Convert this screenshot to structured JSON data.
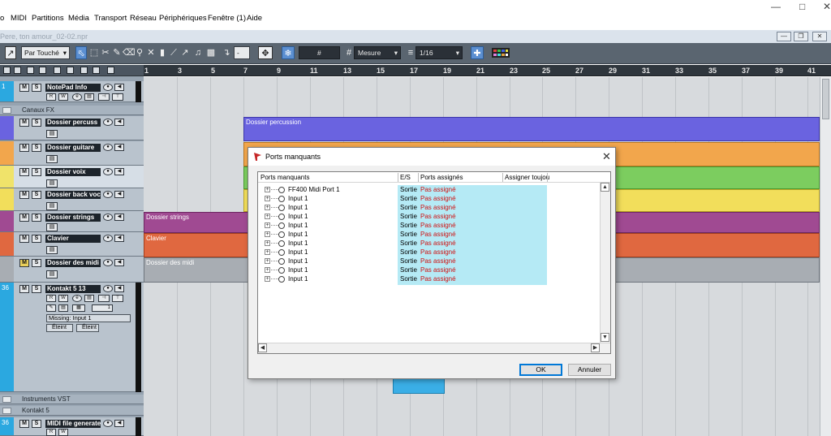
{
  "menubar": {
    "items": [
      "o",
      "MIDI",
      "Partitions",
      "Média",
      "Transport",
      "Réseau",
      "Périphériques",
      "Fenêtre (1)",
      "Aide"
    ]
  },
  "project": {
    "title": "Pere, ton amour_02-02.npr"
  },
  "toolbar": {
    "mode": "Par Touché",
    "grid_symbol": "#",
    "grid_type": "Mesure",
    "quantize": "1/16",
    "dash": "-"
  },
  "ruler": {
    "bars": [
      "1",
      "3",
      "5",
      "7",
      "9",
      "11",
      "13",
      "15",
      "17",
      "19",
      "21",
      "23",
      "25",
      "27",
      "29",
      "31",
      "33",
      "35",
      "37",
      "39",
      "41"
    ]
  },
  "tracks": {
    "notepad": {
      "num": "1",
      "name": "NotePad Info"
    },
    "fx_folder": "Canaux FX",
    "percussion": {
      "name": "Dossier  percuss"
    },
    "guitare": {
      "name": "Dossier guitare"
    },
    "voix": {
      "name": "Dossier voix"
    },
    "backvoc": {
      "name": "Dossier back voc"
    },
    "strings": {
      "name": "Dossier strings"
    },
    "clavier": {
      "name": "Clavier"
    },
    "midi": {
      "name": "Dossier des midi"
    },
    "kontakt": {
      "num": "36",
      "name": "Kontakt 5 13",
      "channel": "1",
      "missing": "Missing: Input 1",
      "off1": "Éteint",
      "off2": "Éteint"
    },
    "instruments_folder": "Instruments VST",
    "kontakt_folder": "Kontakt 5",
    "midi_file": {
      "num": "36",
      "name": "MIDI file generate"
    },
    "btn_m": "M",
    "btn_s": "S",
    "btn_r": "R",
    "btn_w": "W",
    "btn_e": "e"
  },
  "events": {
    "percussion": "Dossier  percussion",
    "strings": "Dossier strings",
    "clavier": "Clavier",
    "midi": "Dossier des midi"
  },
  "colors": {
    "percussion": "#6a63e0",
    "guitare": "#f2a64c",
    "voix": "#7ccd5f",
    "backvoc": "#f2de5b",
    "strings": "#a04a92",
    "clavier": "#e06840",
    "midi": "#a8adb3",
    "kontakt": "#2ba8e0",
    "accent_red": "#d01010",
    "highlight_cyan": "#b5eaf5"
  },
  "dialog": {
    "title": "Ports manquants",
    "columns": [
      "Ports manquants",
      "E/S",
      "Ports assignés",
      "Assigner toujou"
    ],
    "rows": [
      {
        "name": "FF400 Midi Port 1",
        "es": "Sortie",
        "assigned": "Pas assigné"
      },
      {
        "name": "Input 1",
        "es": "Sortie",
        "assigned": "Pas assigné"
      },
      {
        "name": "Input 1",
        "es": "Sortie",
        "assigned": "Pas assigné"
      },
      {
        "name": "Input 1",
        "es": "Sortie",
        "assigned": "Pas assigné"
      },
      {
        "name": "Input 1",
        "es": "Sortie",
        "assigned": "Pas assigné"
      },
      {
        "name": "Input 1",
        "es": "Sortie",
        "assigned": "Pas assigné"
      },
      {
        "name": "Input 1",
        "es": "Sortie",
        "assigned": "Pas assigné"
      },
      {
        "name": "Input 1",
        "es": "Sortie",
        "assigned": "Pas assigné"
      },
      {
        "name": "Input 1",
        "es": "Sortie",
        "assigned": "Pas assigné"
      },
      {
        "name": "Input 1",
        "es": "Sortie",
        "assigned": "Pas assigné"
      },
      {
        "name": "Input 1",
        "es": "Sortie",
        "assigned": "Pas assigné"
      }
    ],
    "ok": "OK",
    "cancel": "Annuler"
  }
}
